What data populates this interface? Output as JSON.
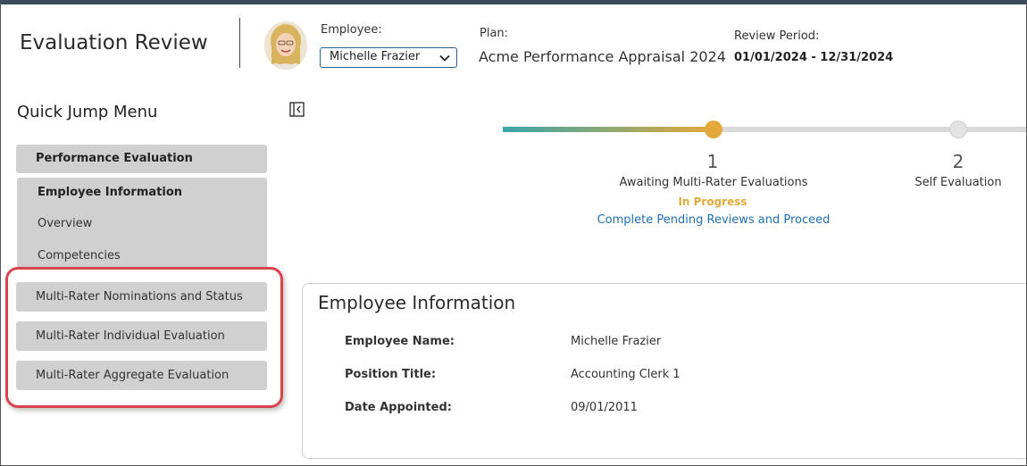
{
  "header": {
    "title": "Evaluation Review",
    "employee_label": "Employee:",
    "employee_selected": "Michelle Frazier",
    "plan_label": "Plan:",
    "plan_value": "Acme Performance Appraisal 2024",
    "period_label": "Review Period:",
    "period_value": "01/01/2024 - 12/31/2024"
  },
  "sidebar": {
    "title": "Quick Jump Menu",
    "group_header": "Performance Evaluation",
    "sub_title": "Employee Information",
    "sub_items": [
      "Overview",
      "Competencies"
    ],
    "multi_rater_items": [
      "Multi-Rater Nominations and Status",
      "Multi-Rater Individual Evaluation",
      "Multi-Rater Aggregate Evaluation"
    ]
  },
  "progress": {
    "steps": [
      {
        "number": "1",
        "name": "Awaiting Multi-Rater Evaluations",
        "status": "In Progress",
        "link": "Complete Pending Reviews and Proceed"
      },
      {
        "number": "2",
        "name": "Self Evaluation"
      }
    ],
    "colors": {
      "active": "#e3a93c",
      "start": "#3aa6aa",
      "inactive": "#d9d9d9"
    }
  },
  "employee_info": {
    "title": "Employee Information",
    "rows": [
      {
        "label": "Employee Name:",
        "value": "Michelle Frazier"
      },
      {
        "label": "Position Title:",
        "value": "Accounting Clerk 1"
      },
      {
        "label": "Date Appointed:",
        "value": "09/01/2011"
      }
    ]
  },
  "icons": {
    "select_chevron": "chevron-down-icon",
    "collapse": "collapse-sidebar-icon",
    "avatar": "user-avatar"
  },
  "accent_colors": {
    "highlight_border": "#d9434d",
    "link": "#1f6fb5"
  }
}
